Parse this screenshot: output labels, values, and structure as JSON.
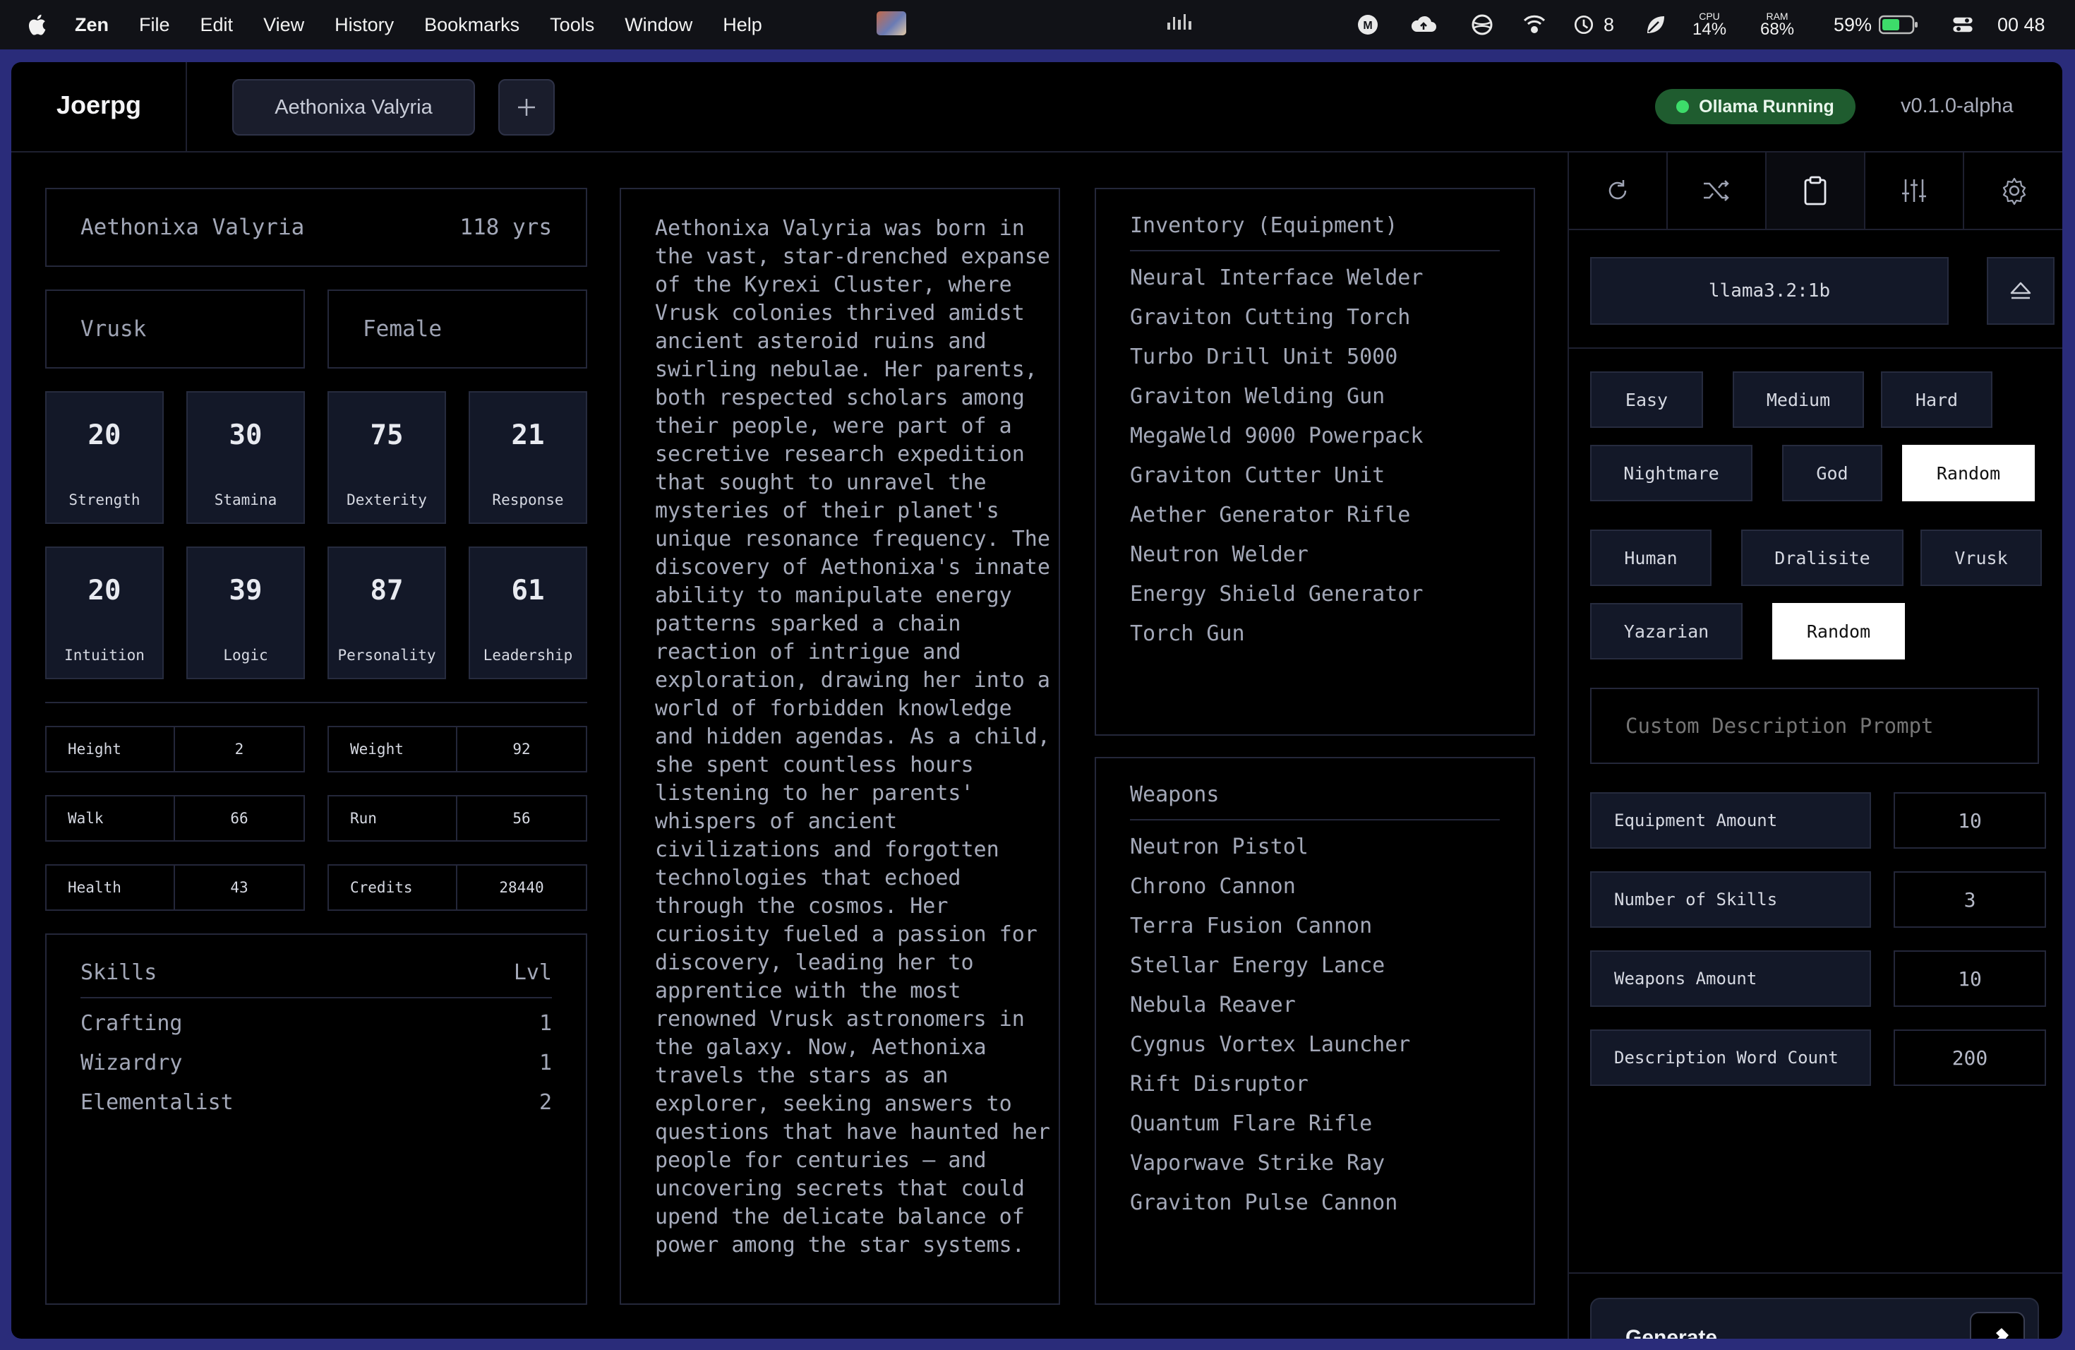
{
  "menubar": {
    "app": "Zen",
    "items": [
      "File",
      "Edit",
      "View",
      "History",
      "Bookmarks",
      "Tools",
      "Window",
      "Help"
    ],
    "updates_count": "8",
    "cpu_label": "CPU",
    "cpu_value": "14%",
    "ram_label": "RAM",
    "ram_value": "68%",
    "battery": "59%",
    "clock": "00 48"
  },
  "header": {
    "logo": "Joerpg",
    "active_tab": "Aethonixa Valyria",
    "status": "Ollama Running",
    "version": "v0.1.0-alpha"
  },
  "character": {
    "name": "Aethonixa Valyria",
    "age": "118 yrs",
    "race": "Vrusk",
    "gender": "Female",
    "stats": [
      {
        "value": "20",
        "label": "Strength"
      },
      {
        "value": "30",
        "label": "Stamina"
      },
      {
        "value": "75",
        "label": "Dexterity"
      },
      {
        "value": "21",
        "label": "Response"
      },
      {
        "value": "20",
        "label": "Intuition"
      },
      {
        "value": "39",
        "label": "Logic"
      },
      {
        "value": "87",
        "label": "Personality"
      },
      {
        "value": "61",
        "label": "Leadership"
      }
    ],
    "attributes": [
      {
        "key": "Height",
        "value": "2"
      },
      {
        "key": "Weight",
        "value": "92"
      },
      {
        "key": "Walk",
        "value": "66"
      },
      {
        "key": "Run",
        "value": "56"
      },
      {
        "key": "Health",
        "value": "43"
      },
      {
        "key": "Credits",
        "value": "28440"
      }
    ],
    "skills_title": "Skills",
    "skills_level_header": "Lvl",
    "skills": [
      {
        "name": "Crafting",
        "level": "1"
      },
      {
        "name": "Wizardry",
        "level": "1"
      },
      {
        "name": "Elementalist",
        "level": "2"
      }
    ],
    "description": "Aethonixa Valyria was born in\nthe vast, star-drenched expanse\nof the Kyrexi Cluster, where\nVrusk colonies thrived amidst\nancient asteroid ruins and\nswirling nebulae. Her parents,\nboth respected scholars among\ntheir people, were part of a\nsecretive research expedition\nthat sought to unravel the\nmysteries of their planet's\nunique resonance frequency. The\ndiscovery of Aethonixa's innate\nability to manipulate energy\npatterns sparked a chain\nreaction of intrigue and\nexploration, drawing her into a\nworld of forbidden knowledge\nand hidden agendas. As a child,\nshe spent countless hours\nlistening to her parents'\nwhispers of ancient\ncivilizations and forgotten\ntechnologies that echoed\nthrough the cosmos. Her\ncuriosity fueled a passion for\ndiscovery, leading her to\napprentice with the most\nrenowned Vrusk astronomers in\nthe galaxy. Now, Aethonixa\ntravels the stars as an\nexplorer, seeking answers to\nquestions that have haunted her\npeople for centuries — and\nuncovering secrets that could\nupend the delicate balance of\npower among the star systems.",
    "inventory_title": "Inventory (Equipment)",
    "inventory": [
      "Neural Interface Welder",
      "Graviton Cutting Torch",
      "Turbo Drill Unit 5000",
      "Graviton Welding Gun",
      "MegaWeld 9000 Powerpack",
      "Graviton Cutter Unit",
      "Aether Generator Rifle",
      "Neutron Welder",
      "Energy Shield Generator",
      "Torch Gun"
    ],
    "weapons_title": "Weapons",
    "weapons": [
      "Neutron Pistol",
      "Chrono Cannon",
      "Terra Fusion Cannon",
      "Stellar Energy Lance",
      "Nebula Reaver",
      "Cygnus Vortex Launcher",
      "Rift Disruptor",
      "Quantum Flare Rifle",
      "Vaporwave Strike Ray",
      "Graviton Pulse Cannon"
    ]
  },
  "panel": {
    "toolbar_icons": [
      "refresh-icon",
      "shuffle-icon",
      "clipboard-icon",
      "sliders-icon",
      "gear-icon"
    ],
    "model": "llama3.2:1b",
    "difficulty": [
      "Easy",
      "Medium",
      "Hard",
      "Nightmare",
      "God",
      "Random"
    ],
    "difficulty_selected": "Random",
    "races": [
      "Human",
      "Dralisite",
      "Vrusk",
      "Yazarian",
      "Random"
    ],
    "race_selected": "Random",
    "custom_prompt_placeholder": "Custom Description Prompt",
    "config": [
      {
        "label": "Equipment Amount",
        "value": "10"
      },
      {
        "label": "Number of Skills",
        "value": "3"
      },
      {
        "label": "Weapons Amount",
        "value": "10"
      },
      {
        "label": "Description Word Count",
        "value": "200"
      }
    ],
    "generate": "Generate"
  },
  "colors": {
    "background": "#000000",
    "card": "#131828",
    "border": "#24273a",
    "status_green": "#1f5c2f",
    "selected": "#ffffff",
    "desktop": "#2a2c7a"
  }
}
